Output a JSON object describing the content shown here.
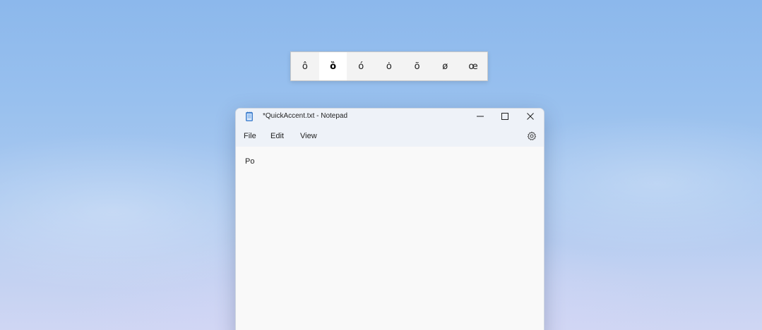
{
  "quick_accent": {
    "keys": [
      "ô",
      "ȍ",
      "ó",
      "ȯ",
      "õ",
      "ø",
      "œ"
    ],
    "selected_index": 1
  },
  "notepad": {
    "title": "*QuickAccent.txt - Notepad",
    "menu": {
      "file": "File",
      "edit": "Edit",
      "view": "View"
    },
    "content": "Po"
  },
  "icons": {
    "app": "notepad-icon",
    "minimize": "minimize-icon",
    "maximize": "maximize-icon",
    "close": "close-icon",
    "settings": "gear-icon"
  },
  "colors": {
    "titlebar": "#eef2f8",
    "editor_bg": "#f9f9f9",
    "accent_bar_bg": "#f3f3f3",
    "accent_selected_bg": "#ffffff"
  }
}
